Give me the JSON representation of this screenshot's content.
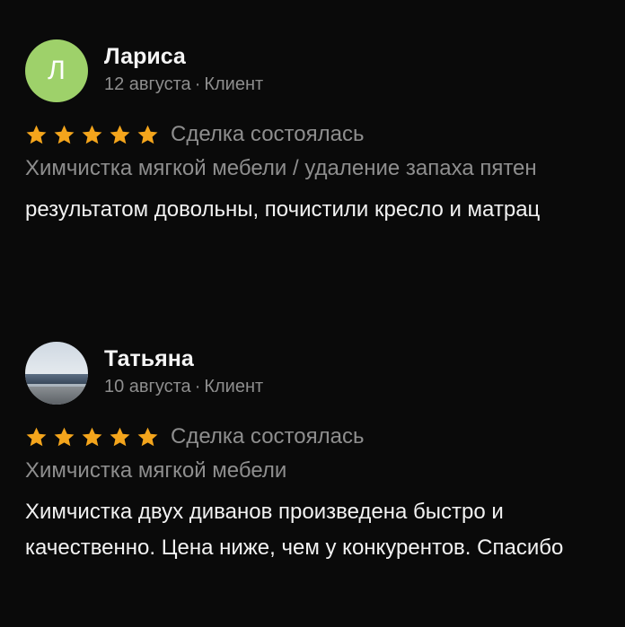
{
  "reviews": [
    {
      "name": "Лариса",
      "avatar_letter": "Л",
      "avatar_color": "#9ed16a",
      "date": "12 августа",
      "role": "Клиент",
      "rating": 5,
      "status": "Сделка состоялась",
      "service": "Химчистка мягкой мебели / удаление запаха пятен",
      "text": "результатом довольны, почистили кресло и матрац"
    },
    {
      "name": "Татьяна",
      "avatar_image": "sea-landscape-photo",
      "date": "10 августа",
      "role": "Клиент",
      "rating": 5,
      "status": "Сделка состоялась",
      "service": "Химчистка мягкой мебели",
      "text": "Химчистка двух диванов произведена быстро и качественно. Цена ниже, чем у конкурентов. Спасибо"
    }
  ],
  "meta_separator": "·",
  "colors": {
    "background": "#0a0a0a",
    "star": "#f4a51c",
    "muted_text": "#8e8e8e"
  }
}
